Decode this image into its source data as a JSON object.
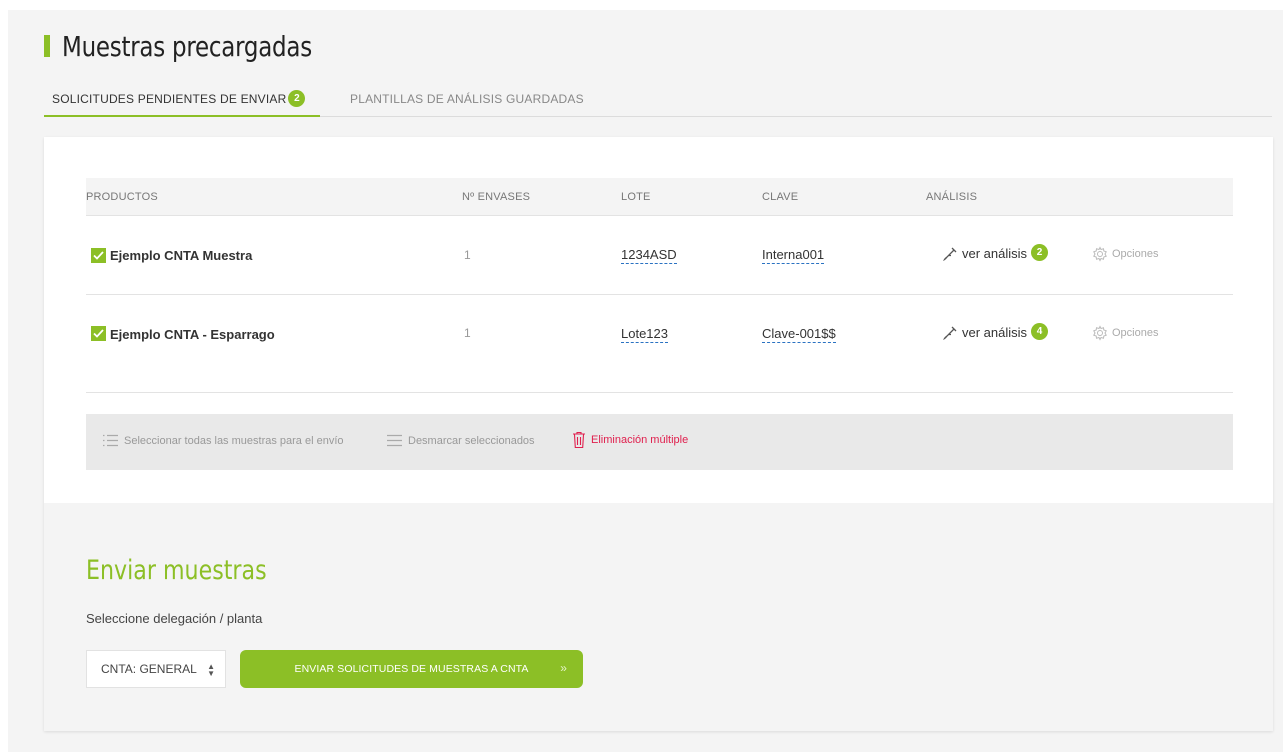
{
  "page": {
    "title": "Muestras precargadas"
  },
  "tabs": [
    {
      "label": "SOLICITUDES PENDIENTES DE ENVIAR",
      "badge": "2",
      "active": true
    },
    {
      "label": "PLANTILLAS DE ANÁLISIS GUARDADAS",
      "active": false
    }
  ],
  "table": {
    "headers": {
      "productos": "PRODUCTOS",
      "envases": "Nº ENVASES",
      "lote": "LOTE",
      "clave": "CLAVE",
      "analisis": "ANÁLISIS"
    },
    "rows": [
      {
        "checked": true,
        "producto": "Ejemplo CNTA Muestra",
        "envases": "1",
        "lote": "1234ASD",
        "clave": "Interna001",
        "analisis_label": "ver análisis",
        "analisis_count": "2",
        "opciones": "Opciones"
      },
      {
        "checked": true,
        "producto": "Ejemplo CNTA - Esparrago",
        "envases": "1",
        "lote": "Lote123",
        "clave": "Clave-001$$",
        "analisis_label": "ver análisis",
        "analisis_count": "4",
        "opciones": "Opciones"
      }
    ]
  },
  "actions": {
    "select_all": "Seleccionar todas las muestras para el envío",
    "unselect": "Desmarcar seleccionados",
    "delete_multiple": "Eliminación múltiple"
  },
  "send": {
    "title": "Enviar muestras",
    "subtitle": "Seleccione delegación / planta",
    "select_value": "CNTA: GENERAL",
    "button_label": "ENVIAR SOLICITUDES DE MUESTRAS A CNTA"
  },
  "icons": {
    "check": "check-icon",
    "analisis": "flask-icon",
    "opciones": "gear-icon",
    "select_all": "list-icon",
    "unselect": "lines-icon",
    "delete": "trash-icon",
    "select_arrows": "sort-arrows-icon",
    "chevron": "double-chevron-right-icon"
  },
  "colors": {
    "accent": "#8cbf26",
    "danger": "#e0204e",
    "link_underline": "#2a72c2"
  }
}
